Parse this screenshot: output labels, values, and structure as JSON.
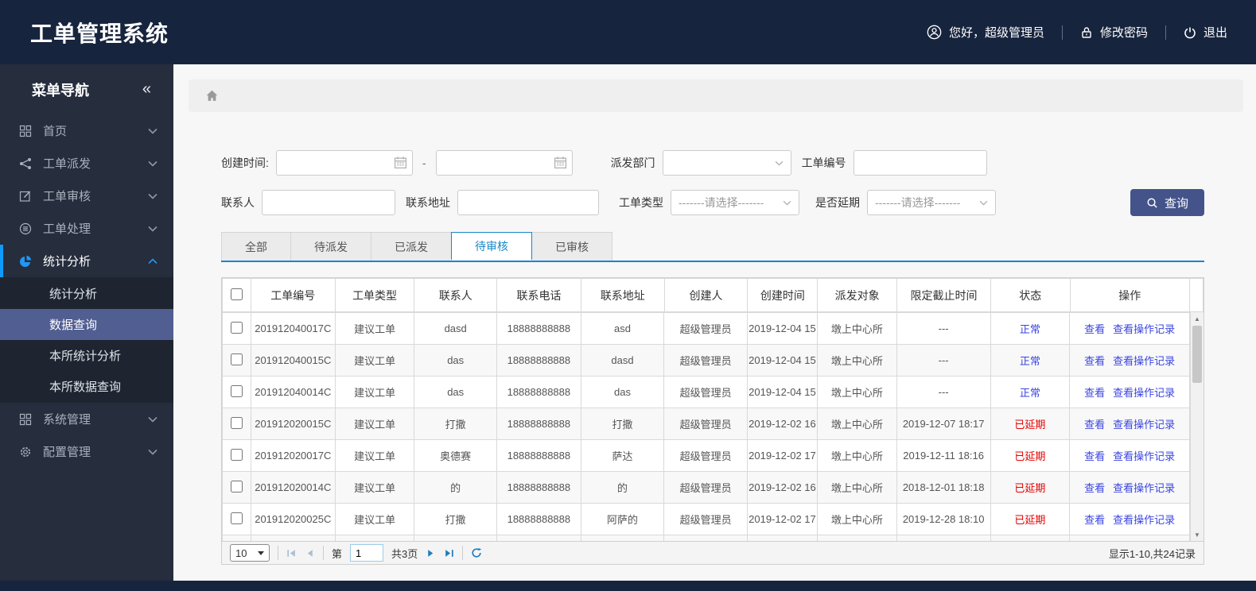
{
  "colors": {
    "header_bg": "#17243d",
    "sidebar_bg": "#262d3d",
    "submenu_bg": "#1e2531",
    "submenu_active_bg": "#515e91",
    "active_marker": "#0e9bff",
    "accent_tab": "#1787c9",
    "button_bg": "#44538a",
    "link_blue": "#3a45e0",
    "status_normal": "#3a45e0",
    "status_delayed": "#e60000",
    "pager_icon_blue": "#1c7dc0",
    "pager_icon_disabled": "#a9c0d4"
  },
  "header": {
    "title": "工单管理系统",
    "greeting": "您好，超级管理员",
    "change_password": "修改密码",
    "logout": "退出"
  },
  "sidebar": {
    "title": "菜单导航",
    "collapse_icon": "«",
    "items": [
      {
        "label": "首页"
      },
      {
        "label": "工单派发"
      },
      {
        "label": "工单审核"
      },
      {
        "label": "工单处理"
      },
      {
        "label": "统计分析",
        "active": true,
        "children": [
          "统计分析",
          "数据查询",
          "本所统计分析",
          "本所数据查询"
        ],
        "active_child": "数据查询"
      },
      {
        "label": "系统管理"
      },
      {
        "label": "配置管理"
      }
    ]
  },
  "filters": {
    "create_time_label": "创建时间:",
    "date_separator": "-",
    "dispatch_dept_label": "派发部门",
    "order_no_label": "工单编号",
    "contact_label": "联系人",
    "address_label": "联系地址",
    "order_type_label": "工单类型",
    "delay_label": "是否延期",
    "select_placeholder": "-------请选择-------",
    "search_button": "查询"
  },
  "tabs": [
    {
      "label": "全部",
      "active": false
    },
    {
      "label": "待派发",
      "active": false
    },
    {
      "label": "已派发",
      "active": false
    },
    {
      "label": "待审核",
      "active": true
    },
    {
      "label": "已审核",
      "active": false
    }
  ],
  "table": {
    "columns": [
      "工单编号",
      "工单类型",
      "联系人",
      "联系电话",
      "联系地址",
      "创建人",
      "创建时间",
      "派发对象",
      "限定截止时间",
      "状态",
      "操作"
    ],
    "actions": [
      "查看",
      "查看操作记录"
    ],
    "rows": [
      {
        "order_no": "201912040017C",
        "type": "建议工单",
        "contact": "dasd",
        "phone": "18888888888",
        "address": "asd",
        "creator": "超级管理员",
        "created": "2019-12-04 15",
        "target": "墩上中心所",
        "deadline": "---",
        "status": "正常",
        "status_type": "normal"
      },
      {
        "order_no": "201912040015C",
        "type": "建议工单",
        "contact": "das",
        "phone": "18888888888",
        "address": "dasd",
        "creator": "超级管理员",
        "created": "2019-12-04 15",
        "target": "墩上中心所",
        "deadline": "---",
        "status": "正常",
        "status_type": "normal"
      },
      {
        "order_no": "201912040014C",
        "type": "建议工单",
        "contact": "das",
        "phone": "18888888888",
        "address": "das",
        "creator": "超级管理员",
        "created": "2019-12-04 15",
        "target": "墩上中心所",
        "deadline": "---",
        "status": "正常",
        "status_type": "normal"
      },
      {
        "order_no": "201912020015C",
        "type": "建议工单",
        "contact": "打撒",
        "phone": "18888888888",
        "address": "打撒",
        "creator": "超级管理员",
        "created": "2019-12-02 16",
        "target": "墩上中心所",
        "deadline": "2019-12-07 18:17",
        "status": "已延期",
        "status_type": "delayed"
      },
      {
        "order_no": "201912020017C",
        "type": "建议工单",
        "contact": "奥德赛",
        "phone": "18888888888",
        "address": "萨达",
        "creator": "超级管理员",
        "created": "2019-12-02 17",
        "target": "墩上中心所",
        "deadline": "2019-12-11 18:16",
        "status": "已延期",
        "status_type": "delayed"
      },
      {
        "order_no": "201912020014C",
        "type": "建议工单",
        "contact": "的",
        "phone": "18888888888",
        "address": "的",
        "creator": "超级管理员",
        "created": "2019-12-02 16",
        "target": "墩上中心所",
        "deadline": "2018-12-01 18:18",
        "status": "已延期",
        "status_type": "delayed"
      },
      {
        "order_no": "201912020025C",
        "type": "建议工单",
        "contact": "打撒",
        "phone": "18888888888",
        "address": "阿萨的",
        "creator": "超级管理员",
        "created": "2019-12-02 17",
        "target": "墩上中心所",
        "deadline": "2019-12-28 18:10",
        "status": "已延期",
        "status_type": "delayed"
      }
    ]
  },
  "pagination": {
    "page_size": "10",
    "page_prefix": "第",
    "current_page": "1",
    "total_pages": "共3页",
    "summary": "显示1-10,共24记录"
  }
}
